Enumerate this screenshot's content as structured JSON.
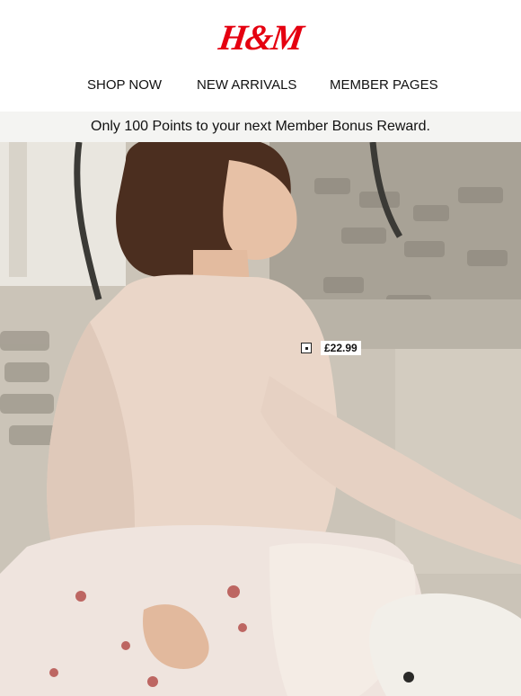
{
  "brand": {
    "logo_text": "H&M",
    "color": "#e50010"
  },
  "nav": [
    {
      "label": "SHOP NOW"
    },
    {
      "label": "NEW ARRIVALS"
    },
    {
      "label": "MEMBER PAGES"
    }
  ],
  "banner": {
    "text": "Only 100 Points to your next Member Bonus Reward."
  },
  "product_tag": {
    "price": "£22.99",
    "icon": "tag-square-icon"
  }
}
